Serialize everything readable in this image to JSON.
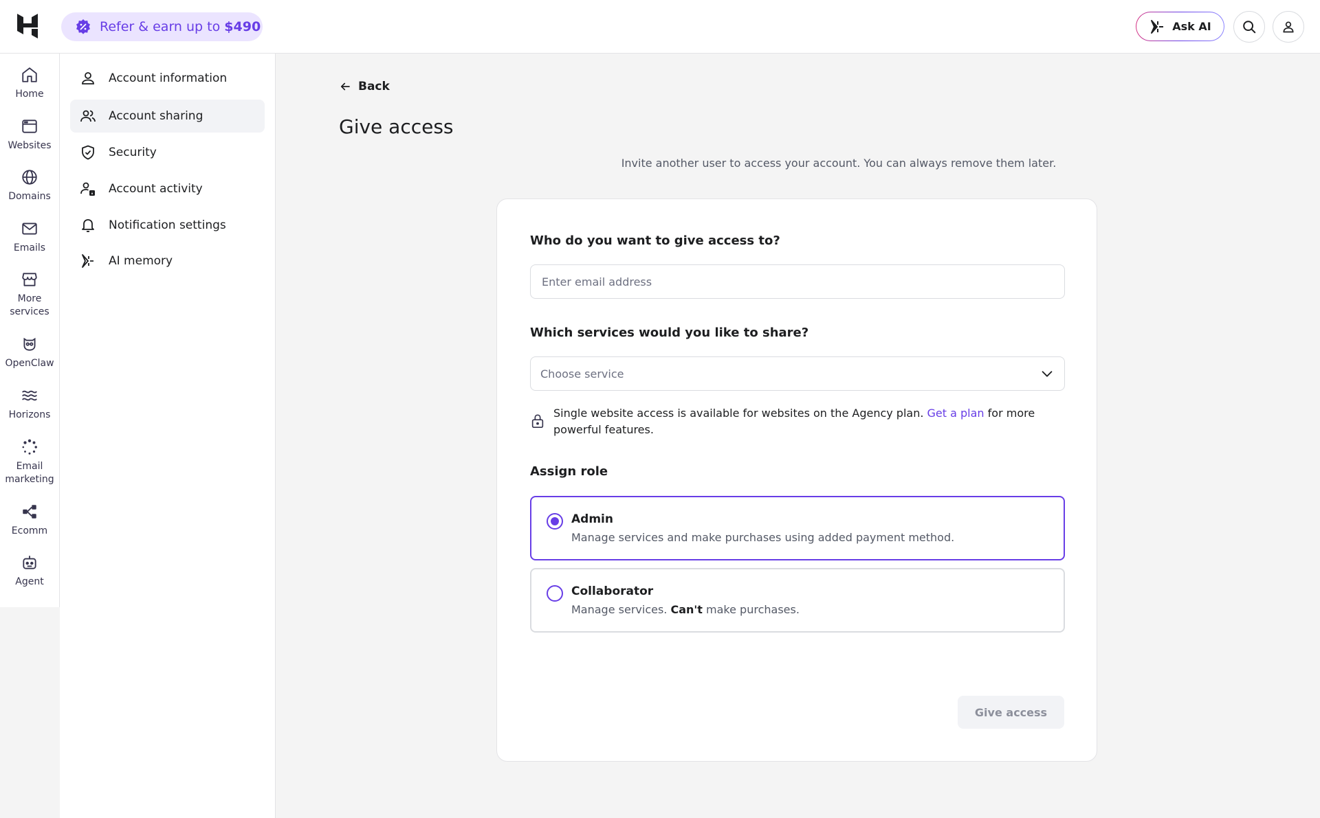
{
  "topbar": {
    "refer_prefix": "Refer & earn up to ",
    "refer_amount": "$490",
    "ask_ai": "Ask AI"
  },
  "rail": [
    {
      "label": "Home",
      "icon": "home-icon"
    },
    {
      "label": "Websites",
      "icon": "browser-window-icon"
    },
    {
      "label": "Domains",
      "icon": "globe-icon"
    },
    {
      "label": "Emails",
      "icon": "mail-icon"
    },
    {
      "label": "More services",
      "icon": "store-icon"
    },
    {
      "label": "OpenClaw",
      "icon": "owl-icon"
    },
    {
      "label": "Horizons",
      "icon": "waves-icon"
    },
    {
      "label": "Email marketing",
      "icon": "loader-dots-icon"
    },
    {
      "label": "Ecomm",
      "icon": "share-nodes-icon"
    },
    {
      "label": "Agent",
      "icon": "robot-icon"
    }
  ],
  "sidebar": {
    "items": [
      {
        "label": "Account information",
        "icon": "user-icon"
      },
      {
        "label": "Account sharing",
        "icon": "users-icon",
        "active": true
      },
      {
        "label": "Security",
        "icon": "shield-check-icon"
      },
      {
        "label": "Account activity",
        "icon": "user-info-icon"
      },
      {
        "label": "Notification settings",
        "icon": "bell-icon"
      },
      {
        "label": "AI memory",
        "icon": "sparkle-icon"
      }
    ]
  },
  "main": {
    "back": "Back",
    "title": "Give access",
    "subtitle": "Invite another user to access your account. You can always remove them later.",
    "form": {
      "q_email": "Who do you want to give access to?",
      "email_placeholder": "Enter email address",
      "q_services": "Which services would you like to share?",
      "service_placeholder": "Choose service",
      "notice_text": "Single website access is available for websites on the Agency plan. ",
      "notice_link": "Get a plan",
      "notice_tail": " for more powerful features.",
      "assign_role": "Assign role",
      "roles": [
        {
          "title": "Admin",
          "desc": "Manage services and make purchases using added payment method.",
          "selected": true
        },
        {
          "title": "Collaborator",
          "desc_pre": "Manage services. ",
          "desc_bold": "Can't",
          "desc_post": " make purchases.",
          "selected": false
        }
      ],
      "submit": "Give access"
    }
  },
  "colors": {
    "accent": "#673de6",
    "accent_light": "#ebe4ff",
    "border": "#dadce0",
    "background": "#f4f4f4"
  }
}
